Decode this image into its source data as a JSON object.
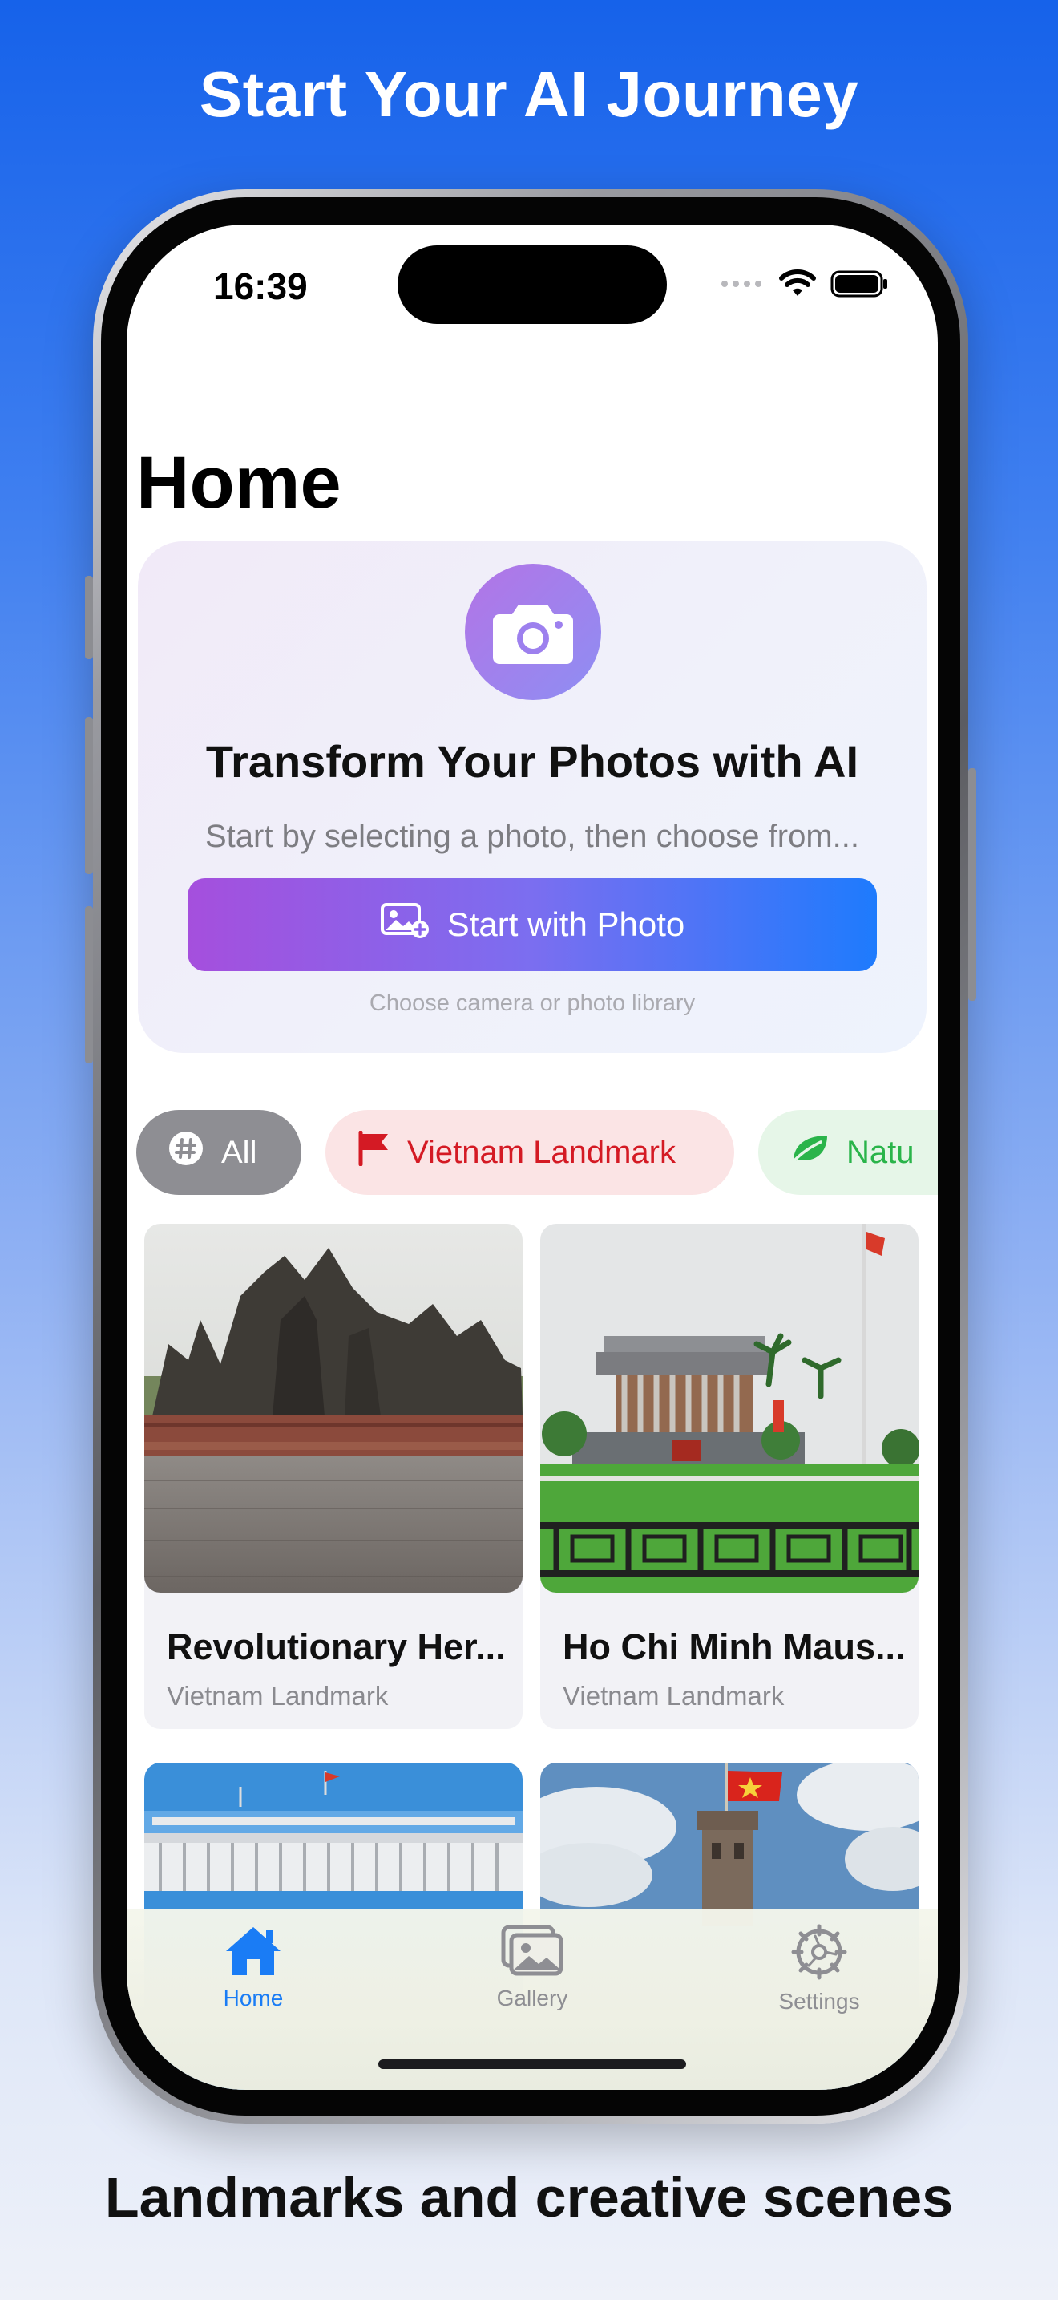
{
  "marketing": {
    "headline": "Start Your AI Journey",
    "caption": "Landmarks and creative scenes"
  },
  "status_bar": {
    "time": "16:39"
  },
  "page": {
    "title": "Home"
  },
  "hero": {
    "title": "Transform Your Photos with AI",
    "subtitle": "Start by selecting a photo, then choose from...",
    "button_label": "Start with Photo",
    "hint": "Choose camera or photo library",
    "icon": "camera-icon"
  },
  "categories": [
    {
      "label": "All",
      "icon": "grid-hash-icon",
      "selected": true
    },
    {
      "label": "Vietnam Landmark",
      "icon": "flag-icon",
      "selected": false
    },
    {
      "label": "Natu",
      "icon": "leaf-icon",
      "selected": false
    }
  ],
  "cards": [
    {
      "title": "Revolutionary Her...",
      "category": "Vietnam Landmark"
    },
    {
      "title": "Ho Chi Minh Maus...",
      "category": "Vietnam Landmark"
    },
    {
      "title": "",
      "category": ""
    },
    {
      "title": "",
      "category": ""
    }
  ],
  "tabs": [
    {
      "label": "Home",
      "icon": "house-icon",
      "active": true
    },
    {
      "label": "Gallery",
      "icon": "photos-icon",
      "active": false
    },
    {
      "label": "Settings",
      "icon": "gear-icon",
      "active": false
    }
  ],
  "colors": {
    "accent": "#1a7cf5",
    "brand_gradient_start": "#a54fdd",
    "brand_gradient_end": "#1e7bfd",
    "landmark_red": "#d41a24",
    "nature_green": "#2ab44a"
  }
}
